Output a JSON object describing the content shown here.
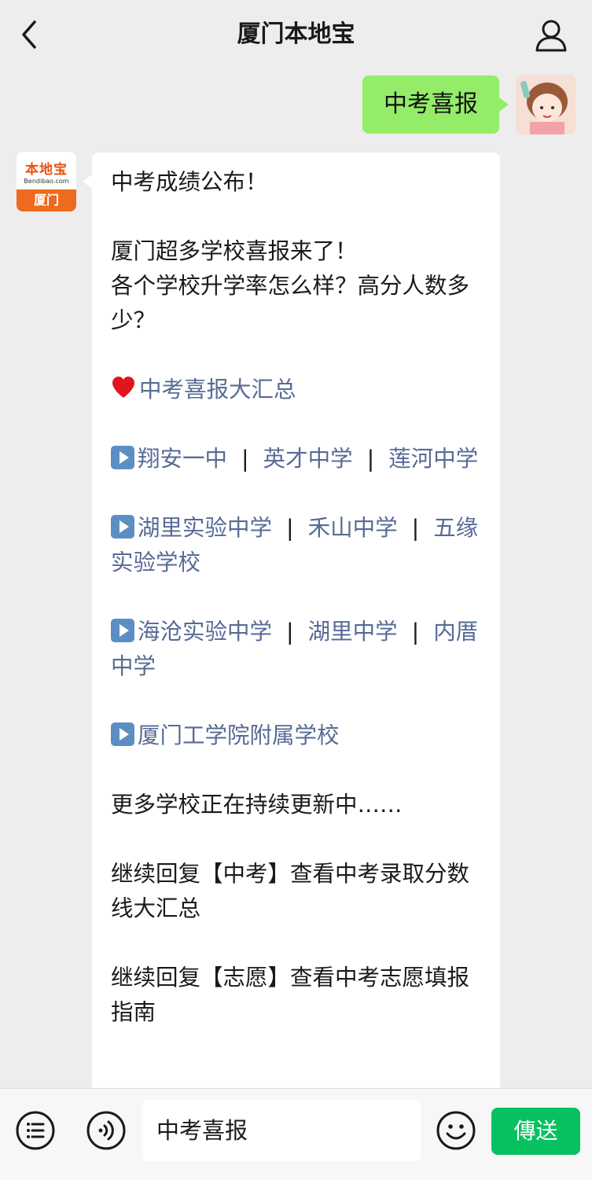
{
  "header": {
    "title": "厦门本地宝",
    "back_icon": "chevron-left-icon",
    "profile_icon": "person-icon"
  },
  "chat": {
    "sent_message": "中考喜报",
    "bot_avatar": {
      "logo_text": "本地宝",
      "logo_url": "Bendibao.com",
      "logo_city": "厦门"
    },
    "received": {
      "headline": "中考成绩公布！",
      "intro_line1": "厦门超多学校喜报来了！",
      "intro_line2": "各个学校升学率怎么样？高分人数多少？",
      "summary_link": "中考喜报大汇总",
      "separator": "|",
      "school_rows": [
        [
          "翔安一中",
          "英才中学",
          "莲河中学"
        ],
        [
          "湖里实验中学",
          "禾山中学",
          "五缘实验学校"
        ],
        [
          "海沧实验中学",
          "湖里中学",
          "内厝中学"
        ],
        [
          "厦门工学院附属学校"
        ]
      ],
      "more_updating": "更多学校正在持续更新中……",
      "reply_scores": "继续回复【中考】查看中考录取分数线大汇总",
      "reply_guide": "继续回复【志愿】查看中考志愿填报指南"
    }
  },
  "bottom_bar": {
    "input_value": "中考喜报",
    "send_label": "傳送",
    "menu_icon": "list-menu-icon",
    "voice_icon": "voice-icon",
    "emoji_icon": "smiley-icon"
  },
  "colors": {
    "background": "#ededed",
    "sent_bubble": "#95ec69",
    "link": "#576b95",
    "send_button": "#07c160",
    "brand_orange": "#ee6a1e"
  }
}
